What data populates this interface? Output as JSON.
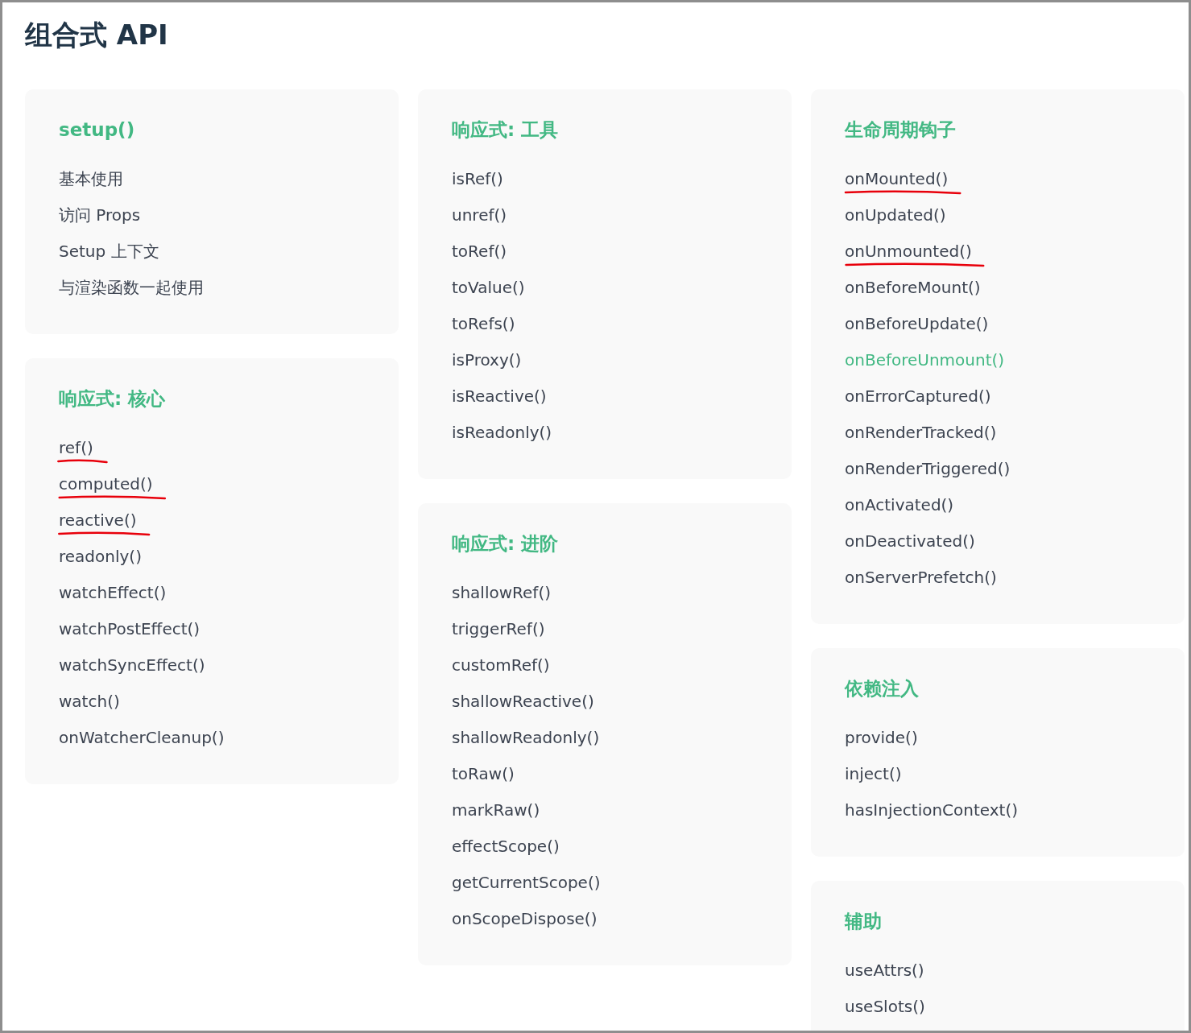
{
  "title": "组合式 API",
  "columns": [
    {
      "cards": [
        {
          "title": "setup()",
          "items": [
            {
              "label": "基本使用",
              "active": false,
              "annotated": false
            },
            {
              "label": "访问 Props",
              "active": false,
              "annotated": false
            },
            {
              "label": "Setup 上下文",
              "active": false,
              "annotated": false
            },
            {
              "label": "与渲染函数一起使用",
              "active": false,
              "annotated": false
            }
          ]
        },
        {
          "title": "响应式: 核心",
          "items": [
            {
              "label": "ref()",
              "active": false,
              "annotated": true
            },
            {
              "label": "computed()",
              "active": false,
              "annotated": true
            },
            {
              "label": "reactive()",
              "active": false,
              "annotated": true
            },
            {
              "label": "readonly()",
              "active": false,
              "annotated": false
            },
            {
              "label": "watchEffect()",
              "active": false,
              "annotated": false
            },
            {
              "label": "watchPostEffect()",
              "active": false,
              "annotated": false
            },
            {
              "label": "watchSyncEffect()",
              "active": false,
              "annotated": false
            },
            {
              "label": "watch()",
              "active": false,
              "annotated": false
            },
            {
              "label": "onWatcherCleanup()",
              "active": false,
              "annotated": false
            }
          ]
        }
      ]
    },
    {
      "cards": [
        {
          "title": "响应式: 工具",
          "items": [
            {
              "label": "isRef()",
              "active": false,
              "annotated": false
            },
            {
              "label": "unref()",
              "active": false,
              "annotated": false
            },
            {
              "label": "toRef()",
              "active": false,
              "annotated": false
            },
            {
              "label": "toValue()",
              "active": false,
              "annotated": false
            },
            {
              "label": "toRefs()",
              "active": false,
              "annotated": false
            },
            {
              "label": "isProxy()",
              "active": false,
              "annotated": false
            },
            {
              "label": "isReactive()",
              "active": false,
              "annotated": false
            },
            {
              "label": "isReadonly()",
              "active": false,
              "annotated": false
            }
          ]
        },
        {
          "title": "响应式: 进阶",
          "items": [
            {
              "label": "shallowRef()",
              "active": false,
              "annotated": false
            },
            {
              "label": "triggerRef()",
              "active": false,
              "annotated": false
            },
            {
              "label": "customRef()",
              "active": false,
              "annotated": false
            },
            {
              "label": "shallowReactive()",
              "active": false,
              "annotated": false
            },
            {
              "label": "shallowReadonly()",
              "active": false,
              "annotated": false
            },
            {
              "label": "toRaw()",
              "active": false,
              "annotated": false
            },
            {
              "label": "markRaw()",
              "active": false,
              "annotated": false
            },
            {
              "label": "effectScope()",
              "active": false,
              "annotated": false
            },
            {
              "label": "getCurrentScope()",
              "active": false,
              "annotated": false
            },
            {
              "label": "onScopeDispose()",
              "active": false,
              "annotated": false
            }
          ]
        }
      ]
    },
    {
      "cards": [
        {
          "title": "生命周期钩子",
          "items": [
            {
              "label": "onMounted()",
              "active": false,
              "annotated": true
            },
            {
              "label": "onUpdated()",
              "active": false,
              "annotated": false
            },
            {
              "label": "onUnmounted()",
              "active": false,
              "annotated": true
            },
            {
              "label": "onBeforeMount()",
              "active": false,
              "annotated": false
            },
            {
              "label": "onBeforeUpdate()",
              "active": false,
              "annotated": false
            },
            {
              "label": "onBeforeUnmount()",
              "active": true,
              "annotated": false
            },
            {
              "label": "onErrorCaptured()",
              "active": false,
              "annotated": false
            },
            {
              "label": "onRenderTracked()",
              "active": false,
              "annotated": false
            },
            {
              "label": "onRenderTriggered()",
              "active": false,
              "annotated": false
            },
            {
              "label": "onActivated()",
              "active": false,
              "annotated": false
            },
            {
              "label": "onDeactivated()",
              "active": false,
              "annotated": false
            },
            {
              "label": "onServerPrefetch()",
              "active": false,
              "annotated": false
            }
          ]
        },
        {
          "title": "依赖注入",
          "items": [
            {
              "label": "provide()",
              "active": false,
              "annotated": false
            },
            {
              "label": "inject()",
              "active": false,
              "annotated": false
            },
            {
              "label": "hasInjectionContext()",
              "active": false,
              "annotated": false
            }
          ]
        },
        {
          "title": "辅助",
          "items": [
            {
              "label": "useAttrs()",
              "active": false,
              "annotated": false
            },
            {
              "label": "useSlots()",
              "active": false,
              "annotated": false
            }
          ]
        }
      ]
    }
  ]
}
